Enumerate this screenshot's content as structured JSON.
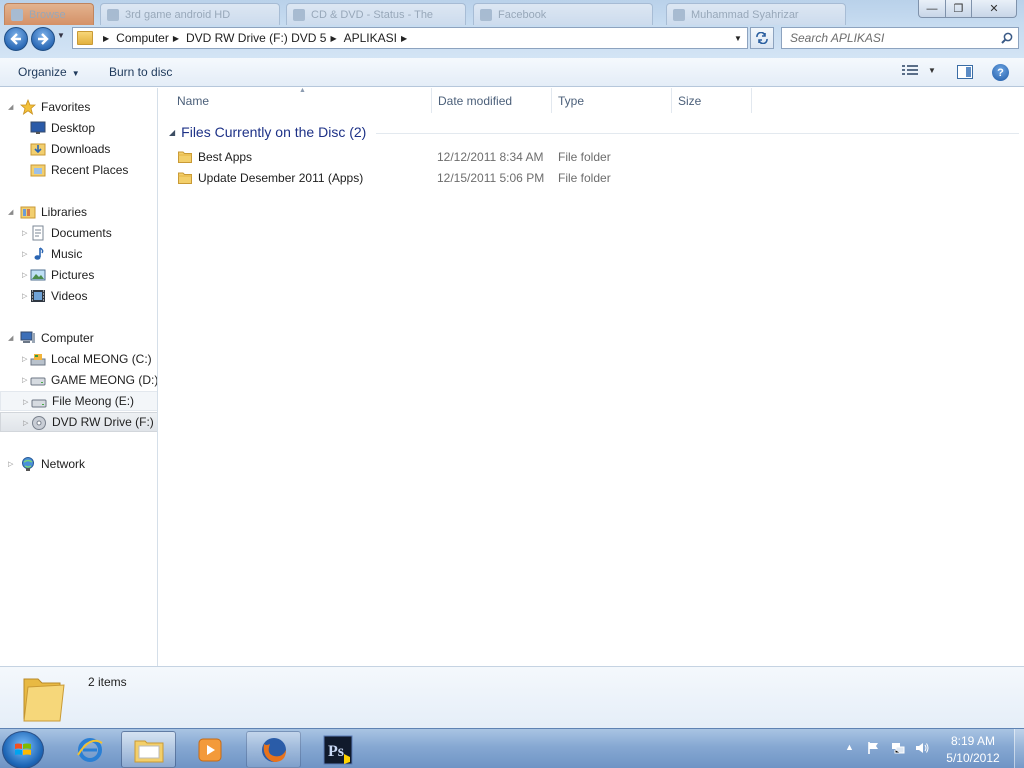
{
  "window": {
    "background_tabs": [
      {
        "label": "Browse"
      },
      {
        "label": "3rd game android HD"
      },
      {
        "label": "CD & DVD - Status - The"
      },
      {
        "label": "Facebook"
      },
      {
        "label": "Muhammad Syahrizar"
      }
    ],
    "minimize_symbol": "—",
    "maximize_symbol": "❐",
    "close_symbol": "✕"
  },
  "address": {
    "breadcrumbs": [
      {
        "label": "Computer"
      },
      {
        "label": "DVD RW Drive (F:) DVD 5"
      },
      {
        "label": "APLIKASI"
      }
    ],
    "search_placeholder": "Search APLIKASI"
  },
  "toolbar": {
    "organize_label": "Organize",
    "burn_label": "Burn to disc"
  },
  "nav": {
    "favorites": {
      "label": "Favorites",
      "items": [
        {
          "label": "Desktop",
          "icon": "desktop-icon"
        },
        {
          "label": "Downloads",
          "icon": "downloads-icon"
        },
        {
          "label": "Recent Places",
          "icon": "recent-places-icon"
        }
      ]
    },
    "libraries": {
      "label": "Libraries",
      "items": [
        {
          "label": "Documents",
          "icon": "documents-icon"
        },
        {
          "label": "Music",
          "icon": "music-icon"
        },
        {
          "label": "Pictures",
          "icon": "pictures-icon"
        },
        {
          "label": "Videos",
          "icon": "videos-icon"
        }
      ]
    },
    "computer": {
      "label": "Computer",
      "items": [
        {
          "label": "Local MEONG (C:)",
          "icon": "local-disk-icon"
        },
        {
          "label": "GAME MEONG (D:)",
          "icon": "drive-icon"
        },
        {
          "label": "File Meong (E:)",
          "icon": "drive-icon"
        },
        {
          "label": "DVD RW Drive (F:) DVD 5",
          "icon": "dvd-drive-icon"
        }
      ]
    },
    "network": {
      "label": "Network"
    }
  },
  "columns": [
    {
      "label": "Name"
    },
    {
      "label": "Date modified"
    },
    {
      "label": "Type"
    },
    {
      "label": "Size"
    }
  ],
  "group": {
    "title": "Files Currently on the Disc (2)"
  },
  "files": [
    {
      "name": "Best Apps",
      "date": "12/12/2011 8:34 AM",
      "type": "File folder",
      "size": ""
    },
    {
      "name": "Update Desember 2011 (Apps)",
      "date": "12/15/2011 5:06 PM",
      "type": "File folder",
      "size": ""
    }
  ],
  "details": {
    "count": "2 items"
  },
  "taskbar": {
    "apps": [
      {
        "name": "internet-explorer"
      },
      {
        "name": "windows-explorer"
      },
      {
        "name": "media-player"
      },
      {
        "name": "firefox"
      },
      {
        "name": "photoshop-app"
      }
    ],
    "clock_time": "8:19 AM",
    "clock_date": "5/10/2012"
  },
  "colors": {
    "accent": "#1e3287",
    "selection": "#e0e4e9",
    "taskbar": "#86a8d2"
  }
}
